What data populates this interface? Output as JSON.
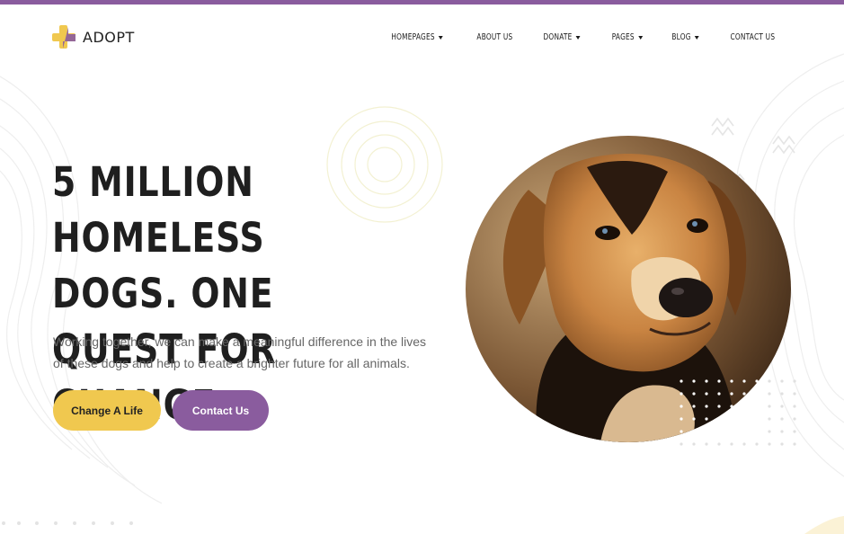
{
  "brand": {
    "name": "ADOPT",
    "colors": {
      "purple": "#8a5c9e",
      "yellow": "#f0c84f",
      "text": "#1f1f1f"
    }
  },
  "nav": {
    "items": [
      {
        "label": "HOMEPAGES",
        "dropdown": true
      },
      {
        "label": "ABOUT US",
        "dropdown": false
      },
      {
        "label": "DONATE",
        "dropdown": true
      },
      {
        "label": "PAGES",
        "dropdown": true
      },
      {
        "label": "BLOG",
        "dropdown": true
      },
      {
        "label": "CONTACT US",
        "dropdown": false
      }
    ]
  },
  "hero": {
    "title_line1": "5 MILLION HOMELESS",
    "title_line2": "DOGS. ONE QUEST FOR",
    "title_line3": "CHANGE.",
    "subtitle": "Working together, we can make a meaningful difference in the lives of these dogs and help to create a brighter future for all animals.",
    "primary_button": "Change A Life",
    "secondary_button": "Contact Us"
  },
  "icons": {
    "logo": "logo-cross-icon",
    "caret": "chevron-down-icon",
    "zigzag": "zigzag-icon"
  }
}
